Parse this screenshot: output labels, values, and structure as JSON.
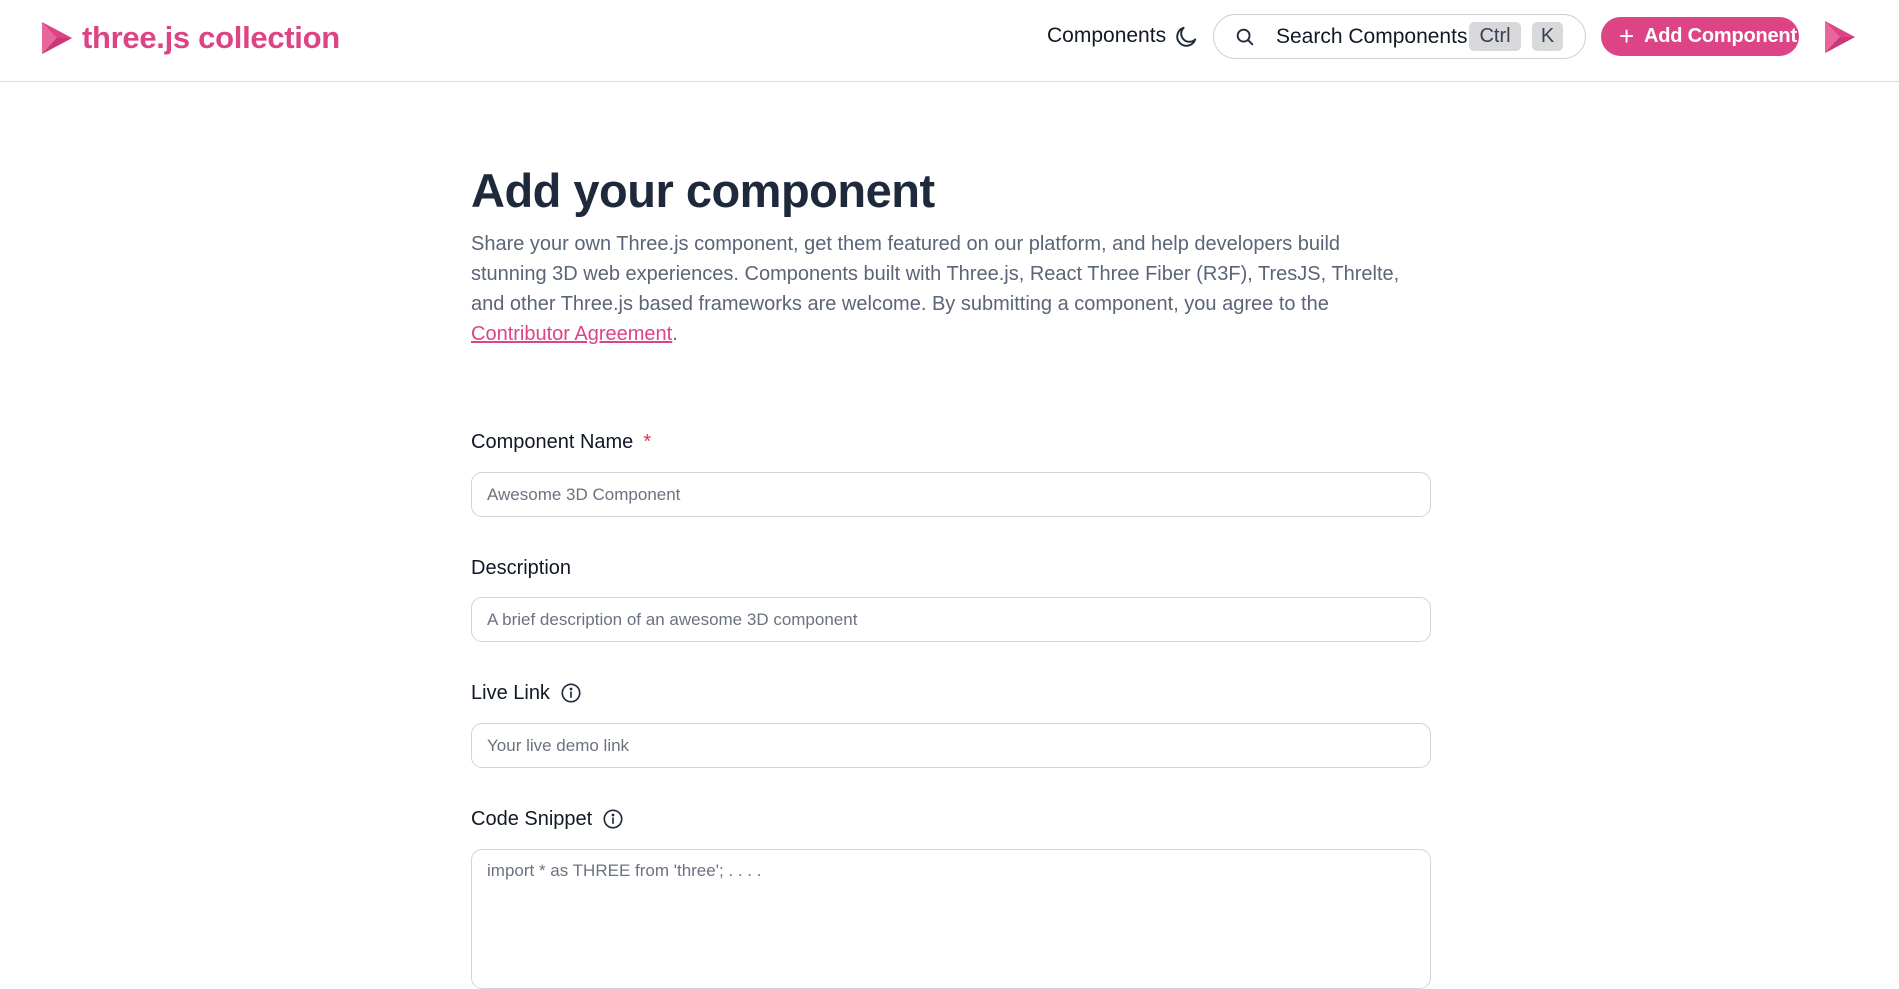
{
  "brand": {
    "name": "three.js collection",
    "logo_icon": "triangle-play-logo-icon",
    "accent_color": "#dc4485"
  },
  "nav": {
    "components_label": "Components",
    "theme_icon": "moon-icon"
  },
  "search": {
    "label": "Search Components",
    "icon": "search-icon",
    "shortcut_modifier": "Ctrl",
    "shortcut_key": "K"
  },
  "header_actions": {
    "add_component_label": "Add Component",
    "add_icon": "plus-icon"
  },
  "page": {
    "title": "Add your component",
    "intro_text": "Share your own Three.js component, get them featured on our platform, and help developers build stunning 3D web experiences. Components built with Three.js, React Three Fiber (R3F), TresJS, Threlte, and other Three.js based frameworks are welcome. By submitting a component, you agree to the ",
    "intro_link": "Contributor Agreement",
    "intro_suffix": "."
  },
  "form": {
    "component_name": {
      "label": "Component Name",
      "required_mark": "*",
      "placeholder": "Awesome 3D Component",
      "value": ""
    },
    "description": {
      "label": "Description",
      "placeholder": "A brief description of an awesome 3D component",
      "value": ""
    },
    "live_link": {
      "label": "Live Link",
      "info_icon": "info-icon",
      "placeholder": "Your live demo link",
      "value": ""
    },
    "code_snippet": {
      "label": "Code Snippet",
      "info_icon": "info-icon",
      "placeholder": "import * as THREE from 'three'; . . . .",
      "value": ""
    }
  }
}
